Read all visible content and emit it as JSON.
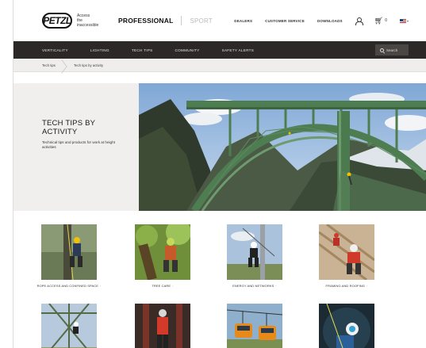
{
  "header": {
    "logo": "PETZL",
    "tagline": [
      "Access",
      "the",
      "inaccessible"
    ],
    "brand_primary": "PROFESSIONAL",
    "brand_secondary": "SPORT",
    "links": [
      "DEALERS",
      "CUSTOMER SERVICE",
      "DOWNLOADS"
    ],
    "cart_count": "0",
    "icons": [
      "user-icon",
      "cart-icon",
      "flag-us-icon"
    ]
  },
  "nav": {
    "items": [
      "VERTICALITY",
      "LIGHTING",
      "TECH TIPS",
      "COMMUNITY",
      "SAFETY ALERTS"
    ],
    "search_label": "Search"
  },
  "breadcrumb": [
    "Tech tips",
    "Tech tips by activity"
  ],
  "hero": {
    "title": "TECH TIPS BY ACTIVITY",
    "subtitle": "Technical tips and products for work at height activities"
  },
  "activities": [
    {
      "label": "ROPE ACCESS AND CONFINED SPACE"
    },
    {
      "label": "TREE CARE"
    },
    {
      "label": "ENERGY AND NETWORKS"
    },
    {
      "label": "FRAMING AND ROOFING"
    },
    {
      "label": ""
    },
    {
      "label": ""
    },
    {
      "label": ""
    },
    {
      "label": ""
    }
  ],
  "colors": {
    "nav_bg": "#2b2827",
    "breadcrumb_bg": "#efeeec",
    "hero_bg": "#f0efed",
    "bridge_green": "#4f7d52"
  }
}
